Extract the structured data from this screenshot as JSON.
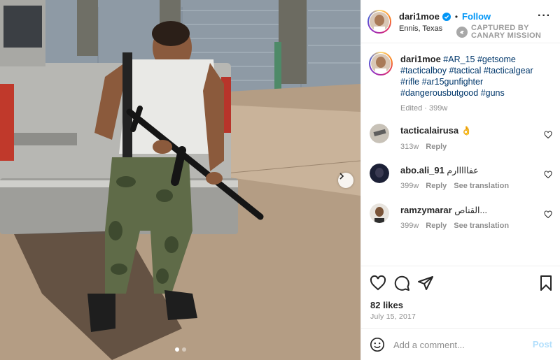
{
  "post": {
    "username": "dari1moe",
    "follow_label": "Follow",
    "location": "Ennis, Texas",
    "more_icon": "more-options-icon",
    "watermark": {
      "line1": "CAPTURED BY",
      "line2": "CANARY MISSION"
    },
    "caption": {
      "username": "dari1moe",
      "hashtags": [
        "#AR_15",
        "#getsome",
        "#tacticalboy",
        "#tactical",
        "#tacticalgear",
        "#rifle",
        "#ar15gunfighter",
        "#dangerousbutgood",
        "#guns"
      ],
      "edited": "Edited",
      "age": "399w"
    },
    "comments": [
      {
        "username": "tacticalairusa",
        "text": "👌",
        "age": "313w",
        "reply": "Reply",
        "translate": ""
      },
      {
        "username": "abo.ali_91",
        "text": "عفااااارم",
        "age": "399w",
        "reply": "Reply",
        "translate": "See translation"
      },
      {
        "username": "ramzymarar",
        "text": "القناص...",
        "age": "399w",
        "reply": "Reply",
        "translate": "See translation"
      }
    ],
    "likes": "82 likes",
    "date": "July 15, 2017",
    "comment_placeholder": "Add a comment...",
    "post_label": "Post",
    "carousel": {
      "count": 2,
      "active": 1
    }
  },
  "colors": {
    "accent": "#0095f6",
    "hashtag": "#00376b",
    "muted": "#8e8e8e",
    "post_disabled": "#b2dffc"
  }
}
